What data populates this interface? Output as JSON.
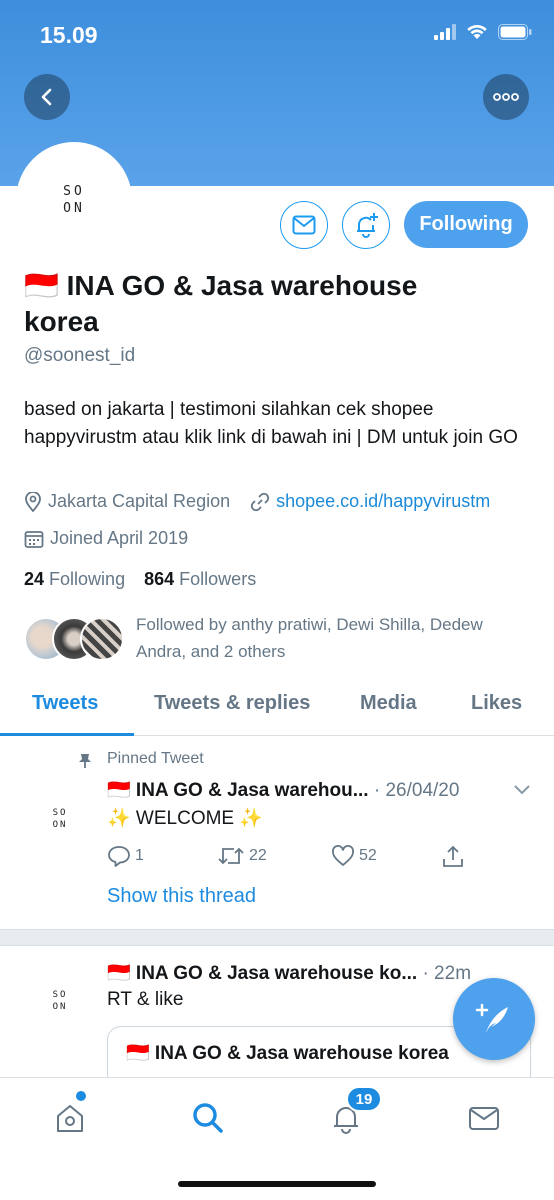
{
  "status_bar": {
    "time": "15.09"
  },
  "profile": {
    "avatar_text": "SO\nON",
    "flag": "🇮🇩",
    "name": "INA GO & Jasa warehouse korea",
    "handle": "@soonest_id",
    "bio": "based on jakarta | testimoni silahkan cek shopee happyvirustm atau klik link di bawah ini | DM untuk join GO",
    "location": "Jakarta Capital Region",
    "website": "shopee.co.id/happyvirustm",
    "joined": "Joined April 2019",
    "following_count": "24",
    "following_label": "Following",
    "followers_count": "864",
    "followers_label": "Followers",
    "followed_by": "Followed by anthy pratiwi, Dewi Shilla, Dedew Andra, and 2 others",
    "follow_button_label": "Following"
  },
  "tabs": [
    {
      "label": "Tweets",
      "active": true
    },
    {
      "label": "Tweets & replies",
      "active": false
    },
    {
      "label": "Media",
      "active": false
    },
    {
      "label": "Likes",
      "active": false
    }
  ],
  "tweets": [
    {
      "pinned_label": "Pinned Tweet",
      "author": "🇮🇩 INA GO & Jasa warehou...",
      "time": "· 26/04/20",
      "text": "✨ WELCOME ✨",
      "replies": "1",
      "retweets": "22",
      "likes": "52",
      "show_thread": "Show this thread"
    },
    {
      "author": "🇮🇩 INA GO & Jasa warehouse ko...",
      "time": "· 22m",
      "text": "RT & like",
      "quote_author": "🇮🇩 INA GO & Jasa warehouse korea"
    }
  ],
  "bottom_nav": {
    "notifications_badge": "19"
  },
  "colors": {
    "accent": "#1d8be0",
    "header": "#4a98e2",
    "muted": "#657786"
  }
}
